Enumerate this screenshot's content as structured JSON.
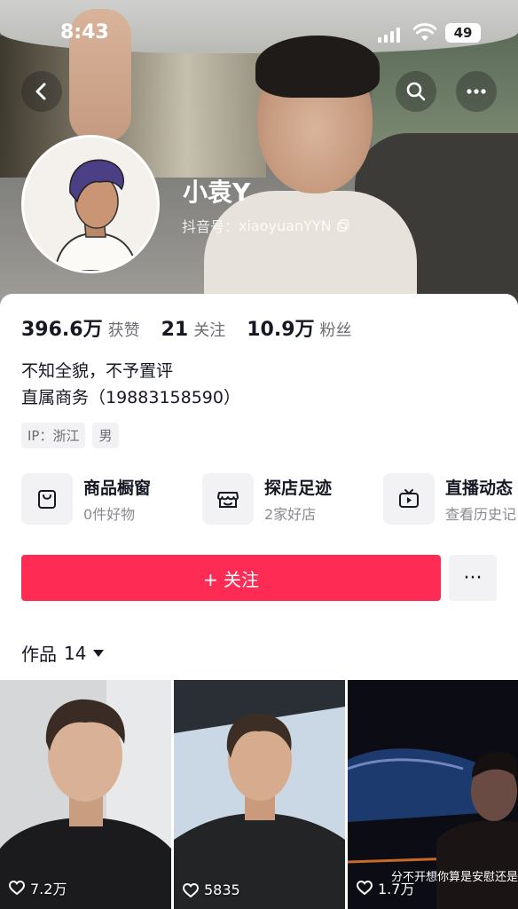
{
  "status_bar": {
    "time": "8:43",
    "battery": "49"
  },
  "profile": {
    "name": "小袁Y",
    "douyin_id_label": "抖音号：",
    "douyin_id": "xiaoyuanYYN"
  },
  "stats": [
    {
      "value": "396.6万",
      "label": "获赞"
    },
    {
      "value": "21",
      "label": "关注"
    },
    {
      "value": "10.9万",
      "label": "粉丝"
    }
  ],
  "bio": {
    "line1": "不知全貌，不予置评",
    "line2": "直属商务（19883158590）"
  },
  "tags": [
    "IP：浙江",
    "男"
  ],
  "features": [
    {
      "title": "商品橱窗",
      "subtitle": "0件好物",
      "icon": "shopping-bag-icon"
    },
    {
      "title": "探店足迹",
      "subtitle": "2家好店",
      "icon": "store-icon"
    },
    {
      "title": "直播动态",
      "subtitle": "查看历史记",
      "icon": "tv-icon"
    }
  ],
  "actions": {
    "follow_label": "+ 关注",
    "more_label": "···"
  },
  "works_tab": {
    "label": "作品",
    "count": "14"
  },
  "videos": [
    {
      "likes": "7.2万",
      "caption": ""
    },
    {
      "likes": "5835",
      "caption": ""
    },
    {
      "likes": "1.7万",
      "caption": "分不开想你算是安慰还是"
    }
  ],
  "colors": {
    "accent": "#fe2c55",
    "text": "#161823",
    "muted": "#8a8b91"
  }
}
